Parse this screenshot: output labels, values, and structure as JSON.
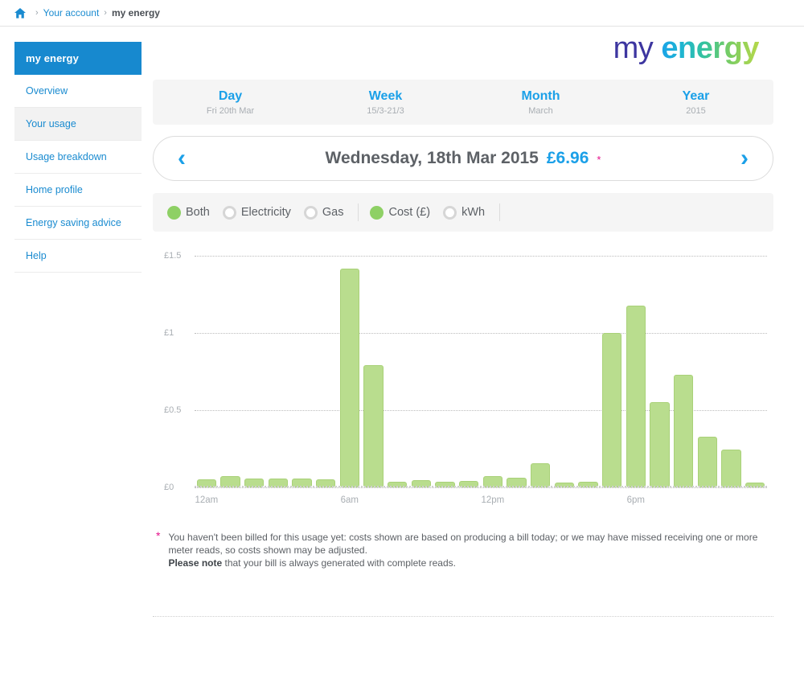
{
  "breadcrumb": {
    "home_icon": "home-icon",
    "sep": "›",
    "items": [
      {
        "label": "Your account",
        "current": false
      },
      {
        "label": "my energy",
        "current": true
      }
    ]
  },
  "logo": {
    "part1": "my",
    "part2": "energy"
  },
  "sidebar": {
    "header": "my energy",
    "items": [
      {
        "label": "Overview",
        "active": false
      },
      {
        "label": "Your usage",
        "active": true
      },
      {
        "label": "Usage breakdown",
        "active": false
      },
      {
        "label": "Home profile",
        "active": false
      },
      {
        "label": "Energy saving advice",
        "active": false
      },
      {
        "label": "Help",
        "active": false
      }
    ]
  },
  "tabs": [
    {
      "label": "Day",
      "sub": "Fri 20th Mar"
    },
    {
      "label": "Week",
      "sub": "15/3-21/3"
    },
    {
      "label": "Month",
      "sub": "March"
    },
    {
      "label": "Year",
      "sub": "2015"
    }
  ],
  "datebar": {
    "prev_icon": "chevron-left-icon",
    "next_icon": "chevron-right-icon",
    "date": "Wednesday, 18th Mar 2015",
    "cost": "£6.96",
    "asterisk": "*"
  },
  "filters": {
    "fuel": [
      {
        "label": "Both",
        "selected": true
      },
      {
        "label": "Electricity",
        "selected": false
      },
      {
        "label": "Gas",
        "selected": false
      }
    ],
    "unit": [
      {
        "label": "Cost (£)",
        "selected": true
      },
      {
        "label": "kWh",
        "selected": false
      }
    ]
  },
  "footnote": {
    "star": "*",
    "line1": "You haven't been billed for this usage yet: costs shown are based on producing a bill today; or we may have missed receiving one or more meter reads, so costs shown may be adjusted.",
    "bold": "Please note",
    "line2": " that your bill is always generated with complete reads."
  },
  "chart_data": {
    "type": "bar",
    "title": "",
    "xlabel": "",
    "ylabel": "Cost (£)",
    "ylim": [
      0,
      1.5
    ],
    "grid": true,
    "legend": false,
    "bar_color": "#b9dd8e",
    "bar_border_color": "#a9d178",
    "y_ticks": [
      0,
      0.5,
      1,
      1.5
    ],
    "y_tick_labels": [
      "£0",
      "£0.5",
      "£1",
      "£1.5"
    ],
    "x_tick_positions": [
      0,
      6,
      12,
      18
    ],
    "x_tick_labels": [
      "12am",
      "6am",
      "12pm",
      "6pm"
    ],
    "categories": [
      "0",
      "1",
      "2",
      "3",
      "4",
      "5",
      "6",
      "7",
      "8",
      "9",
      "10",
      "11",
      "12",
      "13",
      "14",
      "15",
      "16",
      "17",
      "18",
      "19",
      "20",
      "21",
      "22",
      "23"
    ],
    "values": [
      0.05,
      0.075,
      0.055,
      0.055,
      0.055,
      0.05,
      1.415,
      0.79,
      0.035,
      0.045,
      0.035,
      0.04,
      0.075,
      0.065,
      0.155,
      0.03,
      0.035,
      1.0,
      1.175,
      0.55,
      0.73,
      0.33,
      0.245,
      0.025
    ]
  }
}
